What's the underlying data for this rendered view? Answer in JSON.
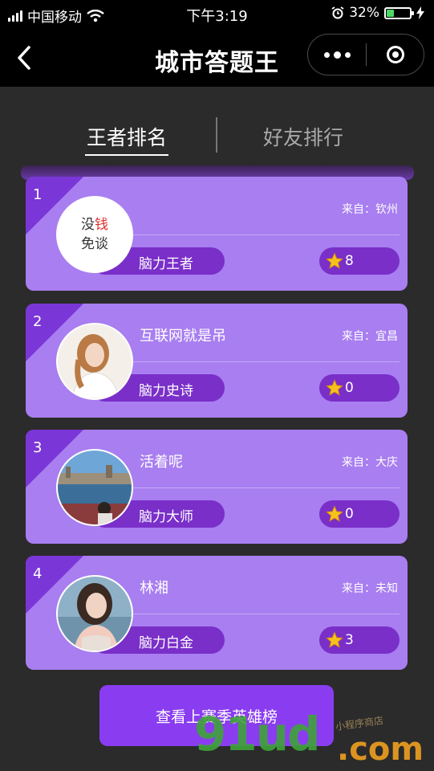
{
  "status_bar": {
    "carrier": "中国移动",
    "time": "下午3:19",
    "battery_percent": "32%",
    "battery_level": 0.32,
    "icons": [
      "signal-icon",
      "wifi-icon",
      "alarm-icon",
      "battery-icon",
      "charging-icon"
    ]
  },
  "nav": {
    "title": "城市答题王",
    "back_icon": "chevron-left-icon",
    "more_icon": "more-dots-icon",
    "close_icon": "miniprogram-close-icon"
  },
  "tabs": [
    {
      "label": "王者排名",
      "active": true
    },
    {
      "label": "好友排行",
      "active": false
    }
  ],
  "ranking": [
    {
      "rank": "1",
      "name": "",
      "from": "来自：钦州",
      "title": "脑力王者",
      "stars": "8",
      "avatar_text_top": "没钱",
      "avatar_text_bottom": "免谈"
    },
    {
      "rank": "2",
      "name": "互联网就是吊",
      "from": "来自：宜昌",
      "title": "脑力史诗",
      "stars": "0"
    },
    {
      "rank": "3",
      "name": "活着呢",
      "from": "来自：大庆",
      "title": "脑力大师",
      "stars": "0"
    },
    {
      "rank": "4",
      "name": "林湘",
      "from": "来自：未知",
      "title": "脑力白金",
      "stars": "3"
    }
  ],
  "season_button": "查看上赛季英雄榜",
  "watermark": {
    "main": "91ud",
    "suffix": ".com",
    "small": "小程序商店"
  },
  "colors": {
    "card": "#a87ef0",
    "accent": "#7a2fc9",
    "button": "#8a3df0",
    "background": "#2b2b2b"
  }
}
